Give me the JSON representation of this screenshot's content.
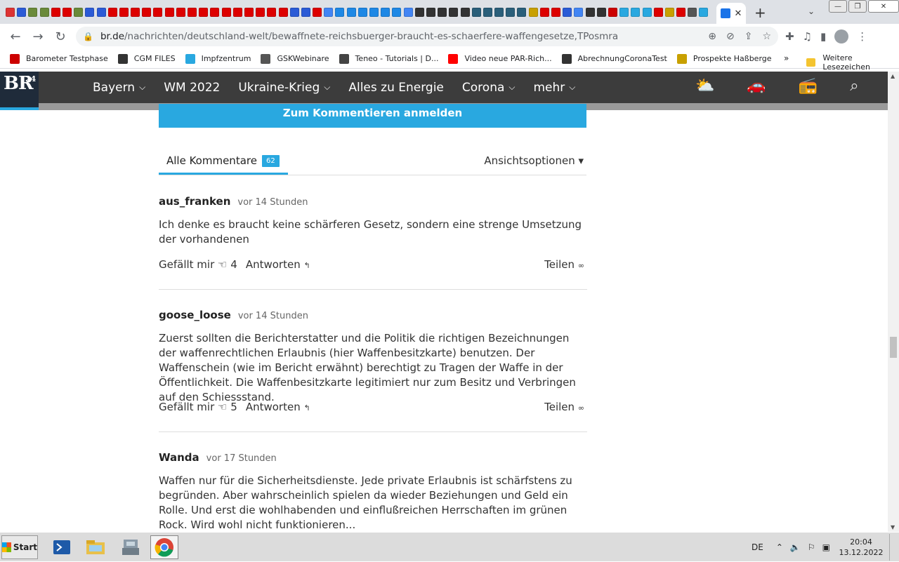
{
  "browser": {
    "url_host": "br.de",
    "url_path": "/nachrichten/deutschland-welt/bewaffnete-reichsbuerger-braucht-es-schaerfere-waffengesetze,TPosmra",
    "tab_colors": [
      "#d33",
      "#2b5bd6",
      "#6a8a3a",
      "#6a8a3a",
      "#d00",
      "#d00",
      "#6a8a3a",
      "#2b5bd6",
      "#2b5bd6",
      "#d00",
      "#d00",
      "#d00",
      "#d00",
      "#d00",
      "#d00",
      "#d00",
      "#d00",
      "#d00",
      "#d00",
      "#d00",
      "#d00",
      "#d00",
      "#d00",
      "#d00",
      "#d00",
      "#2b5bd6",
      "#2b5bd6",
      "#d00",
      "#4285f4",
      "#1e88e5",
      "#1e88e5",
      "#1e88e5",
      "#1e88e5",
      "#1e88e5",
      "#1e88e5",
      "#4285f4",
      "#333",
      "#333",
      "#333",
      "#333",
      "#333",
      "#2a5f7a",
      "#2a5f7a",
      "#2a5f7a",
      "#2a5f7a",
      "#2a5f7a",
      "#c8a000",
      "#d00",
      "#d00",
      "#2b5bd6",
      "#4285f4",
      "#333",
      "#333",
      "#c00",
      "#29a8e0",
      "#29a8e0",
      "#29a8e0",
      "#d00",
      "#c8a000",
      "#d00",
      "#555",
      "#29a8e0"
    ],
    "close_tab": "✕",
    "new_tab": "+",
    "win_buttons": [
      "—",
      "❐",
      "✕"
    ]
  },
  "bookmarks": [
    {
      "label": "Barometer Testphase",
      "color": "#c00"
    },
    {
      "label": "CGM FILES",
      "color": "#333"
    },
    {
      "label": "Impfzentrum",
      "color": "#29a8e0"
    },
    {
      "label": "GSKWebinare",
      "color": "#555"
    },
    {
      "label": "Teneo - Tutorials | D...",
      "color": "#444"
    },
    {
      "label": "Video neue PAR-Rich...",
      "color": "#f00"
    },
    {
      "label": "AbrechnungCoronaTest",
      "color": "#333"
    },
    {
      "label": "Prospekte Haßberge",
      "color": "#c8a000"
    }
  ],
  "bookmarks_more": "»",
  "bookmarks_folder": "Weitere Lesezeichen",
  "site": {
    "logo": "BR",
    "logo_sup": "24",
    "nav": [
      {
        "label": "Bayern",
        "dropdown": true
      },
      {
        "label": "WM 2022",
        "dropdown": false
      },
      {
        "label": "Ukraine-Krieg",
        "dropdown": true
      },
      {
        "label": "Alles zu Energie",
        "dropdown": false
      },
      {
        "label": "Corona",
        "dropdown": true
      },
      {
        "label": "mehr",
        "dropdown": true
      }
    ],
    "icons": [
      "weather-icon",
      "traffic-icon",
      "radio-icon",
      "search-icon"
    ]
  },
  "comments_section": {
    "login_button": "Zum Kommentieren anmelden",
    "tab_label": "Alle Kommentare",
    "count": "62",
    "view_options": "Ansichtsoptionen ▾",
    "like_label": "Gefällt mir",
    "reply_label": "Antworten",
    "share_label": "Teilen",
    "comments": [
      {
        "author": "aus_franken",
        "time": "vor 14 Stunden",
        "text": "Ich denke es braucht keine schärferen Gesetz, sondern eine strenge Umsetzung der vorhandenen",
        "likes": "4"
      },
      {
        "author": "goose_loose",
        "time": "vor 14 Stunden",
        "text": "Zuerst sollten die Berichterstatter und die Politik die richtigen Bezeichnungen der waffenrechtlichen Erlaubnis (hier Waffenbesitzkarte) benutzen. Der Waffenschein (wie im Bericht erwähnt) berechtigt zu Tragen der Waffe in der Öffentlichkeit. Die Waffenbesitzkarte legitimiert nur zum Besitz und Verbringen auf den Schiessstand.",
        "likes": "5"
      },
      {
        "author": "Wanda",
        "time": "vor 17 Stunden",
        "text": "Waffen nur für die Sicherheitsdienste. Jede private Erlaubnis ist schärfstens zu begründen. Aber wahrscheinlich spielen da wieder Beziehungen und Geld ein Rolle. Und erst die wohlhabenden und einflußreichen Herrschaften im grünen Rock. Wird wohl nicht funktionieren..."
      }
    ]
  },
  "taskbar": {
    "start": "Start",
    "lang": "DE",
    "time": "20:04",
    "date": "13.12.2022"
  }
}
